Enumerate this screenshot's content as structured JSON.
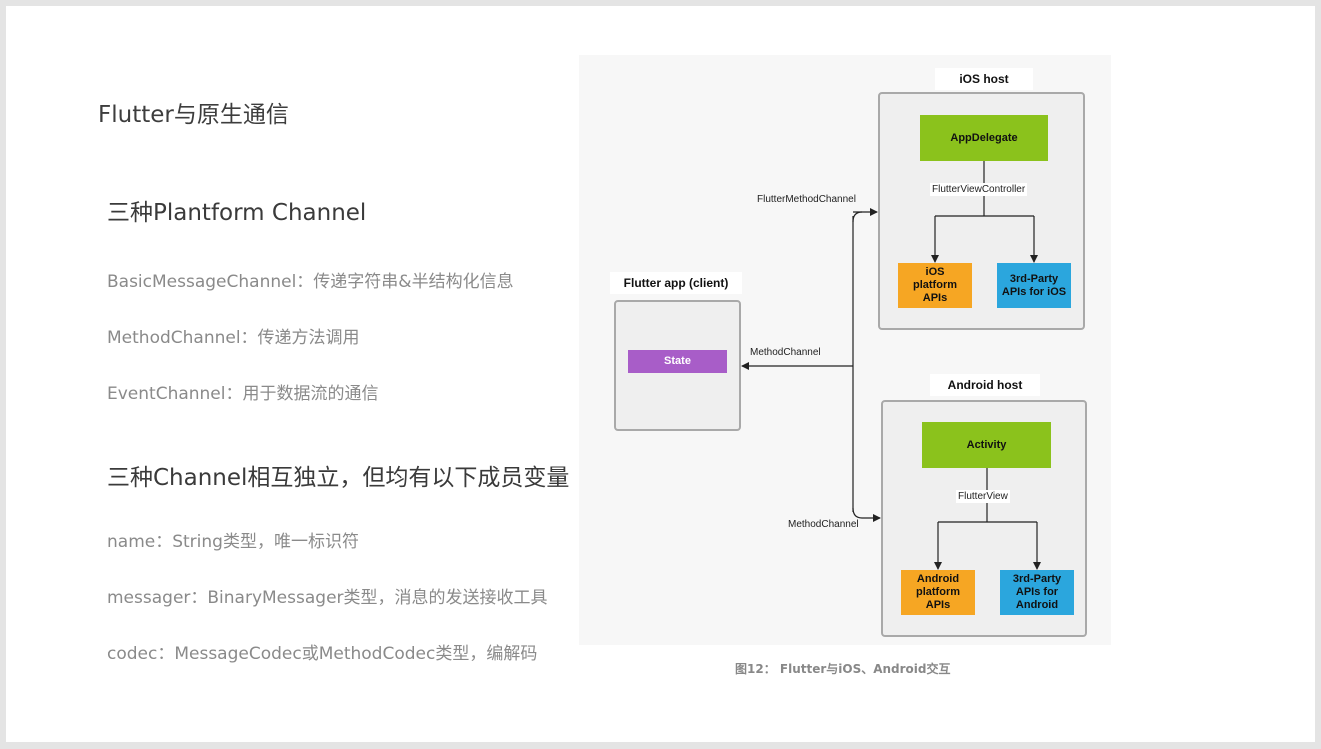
{
  "slide": {
    "title": "Flutter与原生通信",
    "section1": {
      "heading": "三种Plantform Channel",
      "items": [
        "BasicMessageChannel：传递字符串&半结构化信息",
        "MethodChannel：传递方法调用",
        "EventChannel：用于数据流的通信"
      ]
    },
    "section2": {
      "heading": "三种Channel相互独立，但均有以下成员变量",
      "items": [
        "name：String类型，唯一标识符",
        "messager：BinaryMessager类型，消息的发送接收工具",
        "codec：MessageCodec或MethodCodec类型，编解码"
      ]
    }
  },
  "diagram": {
    "client": {
      "title": "Flutter app (client)",
      "state": "State"
    },
    "ios": {
      "title": "iOS host",
      "app_delegate": "AppDelegate",
      "controller_label": "FlutterViewController",
      "platform_apis": [
        "iOS",
        "platform",
        "APIs"
      ],
      "third_party": [
        "3rd-Party",
        "APIs for iOS"
      ]
    },
    "android": {
      "title": "Android host",
      "activity": "Activity",
      "view_label": "FlutterView",
      "platform_apis": [
        "Android",
        "platform",
        "APIs"
      ],
      "third_party": [
        "3rd-Party",
        "APIs for",
        "Android"
      ]
    },
    "edges": {
      "flutter_method_channel": "FlutterMethodChannel",
      "method_channel_client": "MethodChannel",
      "method_channel_android": "MethodChannel"
    },
    "caption": "图12： Flutter与iOS、Android交互"
  },
  "colors": {
    "green": "#8bc21c",
    "orange": "#f6a623",
    "blue": "#2ba6dd",
    "purple": "#a85dc8",
    "box_border": "#a9a9a9"
  }
}
